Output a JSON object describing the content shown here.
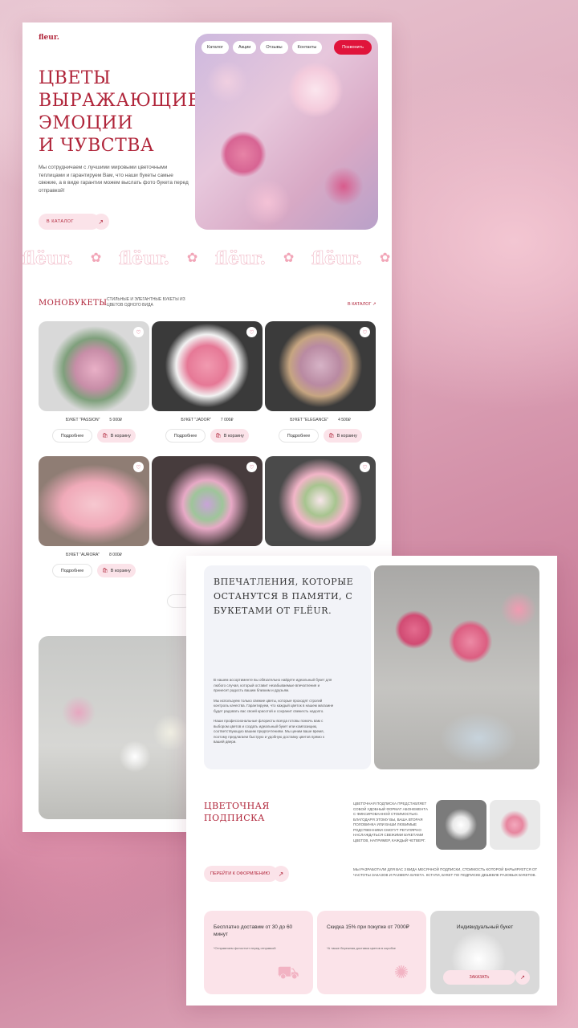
{
  "brand": {
    "logo": "fleur."
  },
  "nav": {
    "items": [
      "Каталог",
      "Акции",
      "Отзывы",
      "Контакты"
    ],
    "call": "Позвонить"
  },
  "hero": {
    "title_lines": [
      "ЦВЕТЫ",
      "ВЫРАЖАЮЩИЕ",
      "ЭМОЦИИ",
      "И ЧУВСТВА"
    ],
    "desc": "Мы сотрудничаем с лучшими мировыми цветочными теплицами и гарантируем Вам, что наши букеты самые свежие, а в виде гарантии можем выслать фото букета перед отправкой!",
    "button": "В КАТАЛОГ"
  },
  "marquee": {
    "word": "flëur."
  },
  "mono": {
    "title": "МОНОБУКЕТЫ",
    "subtitle": "СТИЛЬНЫЕ И ЭЛЕГАНТНЫЕ БУКЕТЫ ИЗ ЦВЕТОВ ОДНОГО ВИДА",
    "link": "В КАТАЛОГ"
  },
  "products": [
    {
      "name": "БУКЕТ \"PASSION\"",
      "price": "5 000₽"
    },
    {
      "name": "БУКЕТ \"JADOR\"",
      "price": "7 000₽"
    },
    {
      "name": "БУКЕТ \"ELEGANCE\"",
      "price": "4 500₽"
    },
    {
      "name": "БУКЕТ \"AURORA\"",
      "price": "8 000₽"
    },
    {
      "name": "",
      "price": ""
    },
    {
      "name": "",
      "price": ""
    }
  ],
  "product_buttons": {
    "more": "Подробнее",
    "cart": "В корзину"
  },
  "intro": {
    "title": "ВПЕЧАТЛЕНИЯ, КОТОРЫЕ ОСТАНУТСЯ В ПАМЯТИ, С БУКЕТАМИ ОТ FLËUR.",
    "p1": "В нашем ассортименте вы обязательно найдете идеальный букет для любого случая, который оставит незабываемые впечатления и принесет радость вашим близким и друзьям.",
    "p2": "Мы используем только свежие цветы, которые проходят строгий контроль качества. Гарантируем, что каждый цветок в нашем магазине будет радовать вас своей красотой и сохранит свежесть надолго.",
    "p3": "Наши профессиональные флористы всегда готовы помочь вам с выбором цветов и создать идеальный букет или композицию, соответствующую вашим предпочтениям. Мы ценим ваше время, поэтому предлагаем быструю и удобную доставку цветов прямо к вашей двери."
  },
  "subscription": {
    "title_lines": [
      "ЦВЕТОЧНАЯ",
      "ПОДПИСКА"
    ],
    "text": "ЦВЕТОЧНАЯ ПОДПИСКА ПРЕДСТАВЛЯЕТ СОБОЙ УДОБНЫЙ ФОРМАТ АБОНЕМЕНТА С ФИКСИРОВАННОЙ СТОИМОСТЬЮ. БЛАГОДАРЯ ЭТОМУ ВЫ, ВАША ВТОРАЯ ПОЛОВИНКА ИЛИ ВАШИ ЛЮБИМЫЕ РОДСТВЕННИКИ СМОГУТ РЕГУЛЯРНО НАСЛАЖДАТЬСЯ СВЕЖИМИ БУКЕТАМИ ЦВЕТОВ, НАПРИМЕР, КАЖДЫЙ ЧЕТВЕРГ.",
    "button": "ПЕРЕЙТИ К ОФОРМЛЕНИЮ",
    "note": "МЫ РАЗРАБОТАЛИ ДЛЯ ВАС 3 ВИДА МЕСЯЧНОЙ ПОДПИСКИ, СТОИМОСТЬ КОТОРОЙ ВАРЬИРУЕТСЯ ОТ ЧАСТОТЫ ЗАКАЗОВ И РАЗМЕРА БУКЕТА. КСТАТИ, БУКЕТ ПО ПОДПИСКЕ ДЕШЕВЛЕ РАЗОВЫХ БУКЕТОВ."
  },
  "features": [
    {
      "title": "Бесплатно доставим от 30 до 60 минут",
      "note": "*Отправляем фотоотчет перед отправкой"
    },
    {
      "title": "Скидка 15% при покупке от 7000₽",
      "note": "*А также бережная доставка цветов в коробке"
    },
    {
      "title": "Индивидуальный букет",
      "button": "ЗАКАЗАТЬ"
    }
  ]
}
